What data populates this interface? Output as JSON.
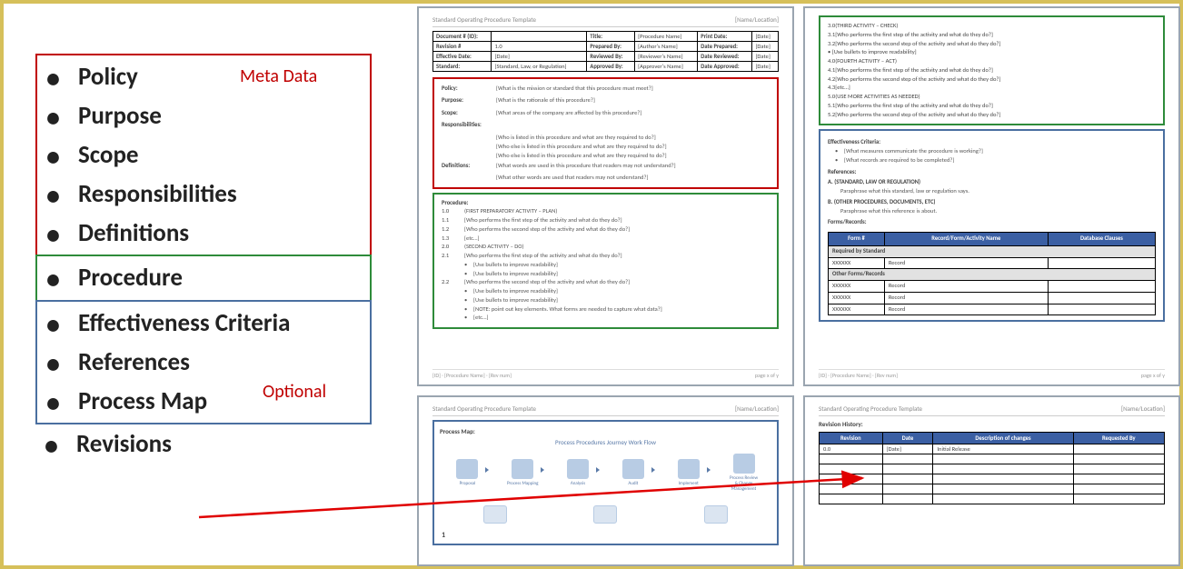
{
  "sections": {
    "metaLabel": "Meta Data",
    "optLabel": "Optional",
    "meta": [
      "Policy",
      "Purpose",
      "Scope",
      "Responsibilities",
      "Definitions"
    ],
    "proc": [
      "Procedure"
    ],
    "opt": [
      "Effectiveness Criteria",
      "References",
      "Process Map"
    ],
    "tail": [
      "Revisions"
    ]
  },
  "docHeader": {
    "left": "Standard Operating Procedure Template",
    "right": "[Name/Location]"
  },
  "page1": {
    "meta": [
      [
        "Document # (ID):",
        "",
        "Title:",
        "[Procedure Name]",
        "Print Date:",
        "[Date]"
      ],
      [
        "Revision #",
        "1.0",
        "Prepared By:",
        "[Author's Name]",
        "Date Prepared:",
        "[Date]"
      ],
      [
        "Effective Date:",
        "[Date]",
        "Reviewed By:",
        "[Reviewer's Name]",
        "Date Reviewed:",
        "[Date]"
      ],
      [
        "Standard:",
        "[Standard, Law, or Regulation]",
        "Approved By:",
        "[Approver's Name]",
        "Date Approved:",
        "[Date]"
      ]
    ],
    "red": {
      "policy": [
        "Policy:",
        "[What is the mission or standard that this procedure must meet?]"
      ],
      "purpose": [
        "Purpose:",
        "[What is the rationale of this procedure?]"
      ],
      "scope": [
        "Scope:",
        "[What areas of the company are affected by this procedure?]"
      ],
      "respHdr": "Responsibilities:",
      "resp": [
        "[Who is listed in this procedure and what are they required to do?]",
        "[Who else is listed in this procedure and what are they required to do?]",
        "[Who else is listed in this procedure and what are they required to do?]"
      ],
      "defHdr": "Definitions:",
      "def": [
        "[What words are used in this procedure that readers may not understand?]",
        "[What other words are used that readers may not understand?]"
      ]
    },
    "green": {
      "hdr": "Procedure:",
      "items": [
        {
          "n": "1.0",
          "t": "(FIRST PREPARATORY ACTIVITY – PLAN)"
        },
        {
          "n": "1.1",
          "t": "[Who performs the first step of the activity and what do they do?]"
        },
        {
          "n": "1.2",
          "t": "[Who performs the second step of the activity and what do they do?]"
        },
        {
          "n": "1.3",
          "t": "[etc…]"
        },
        {
          "n": "2.0",
          "t": "(SECOND ACTIVITY – DO)"
        },
        {
          "n": "2.1",
          "t": "[Who performs the first step of the activity and what do they do?]"
        }
      ],
      "bullets1": [
        "[Use bullets to improve readability]",
        "[Use bullets to improve readability]"
      ],
      "item22": {
        "n": "2.2",
        "t": "[Who performs the second step of the activity and what do they do?]"
      },
      "bullets2": [
        "[Use bullets to improve readability]",
        "[Use bullets to improve readability]",
        "[NOTE: point out key elements. What forms are needed to capture what data?]",
        "[etc…]"
      ]
    },
    "footerLeft": "[ID] · [Procedure Name] · [Rev num]",
    "footerRight": "page x of y"
  },
  "page2": {
    "green": [
      {
        "n": "3.0",
        "t": "(THIRD ACTIVITY – CHECK)"
      },
      {
        "n": "3.1",
        "t": "[Who performs the first step of the activity and what do they do?]"
      },
      {
        "n": "3.2",
        "t": "[Who performs the second step of the activity and what do they do?]"
      },
      {
        "n": "",
        "t": "• [Use bullets to improve readability]"
      },
      {
        "n": "4.0",
        "t": "(FOURTH ACTIVITY – ACT)"
      },
      {
        "n": "4.1",
        "t": "[Who performs the first step of the activity and what do they do?]"
      },
      {
        "n": "4.2",
        "t": "[Who performs the second step of the activity and what do they do?]"
      },
      {
        "n": "4.3",
        "t": "[etc…]"
      },
      {
        "n": "5.0",
        "t": "(USE MORE ACTIVITIES AS NEEDED)"
      },
      {
        "n": "5.1",
        "t": "[Who performs the first step of the activity and what do they do?]"
      },
      {
        "n": "5.2",
        "t": "[Who performs the second step of the activity and what do they do?]"
      }
    ],
    "blue": {
      "effHdr": "Effectiveness Criteria:",
      "eff": [
        "[What measures communicate the procedure is working?]",
        "[What records are required to be completed?]"
      ],
      "refHdr": "References:",
      "refA": {
        "l": "A.",
        "t": "(STANDARD, LAW OR REGULATION)",
        "p": "Paraphrase what this standard, law or regulation says."
      },
      "refB": {
        "l": "B.",
        "t": "(OTHER PROCEDURES, DOCUMENTS, ETC)",
        "p": "Paraphrase what this reference is about."
      },
      "formsHdr": "Forms/Records:",
      "tableHead": [
        "Form #",
        "Record/Form/Activity Name",
        "Database Clauses"
      ],
      "group1": "Required by Standard",
      "rows1": [
        [
          "XXXXXX",
          "Record",
          ""
        ]
      ],
      "group2": "Other Forms/Records",
      "rows2": [
        [
          "XXXXXX",
          "Record",
          ""
        ],
        [
          "XXXXXX",
          "Record",
          ""
        ],
        [
          "XXXXXX",
          "Record",
          ""
        ]
      ]
    }
  },
  "page3": {
    "title": "Process Map:",
    "subtitle": "Process Procedures Journey Work Flow",
    "nodes": [
      "Proposal",
      "Process Mapping",
      "Analysis",
      "Audit",
      "Implement",
      "Process Review & Change Management"
    ],
    "pageNum": "1"
  },
  "page4": {
    "title": "Revision History:",
    "head": [
      "Revision",
      "Date",
      "Description of changes",
      "Requested By"
    ],
    "rows": [
      [
        "0.0",
        "[Date]",
        "Initial Release",
        ""
      ],
      [
        "",
        "",
        "",
        ""
      ],
      [
        "",
        "",
        "",
        ""
      ],
      [
        "",
        "",
        "",
        ""
      ],
      [
        "",
        "",
        "",
        ""
      ],
      [
        "",
        "",
        "",
        ""
      ]
    ]
  }
}
